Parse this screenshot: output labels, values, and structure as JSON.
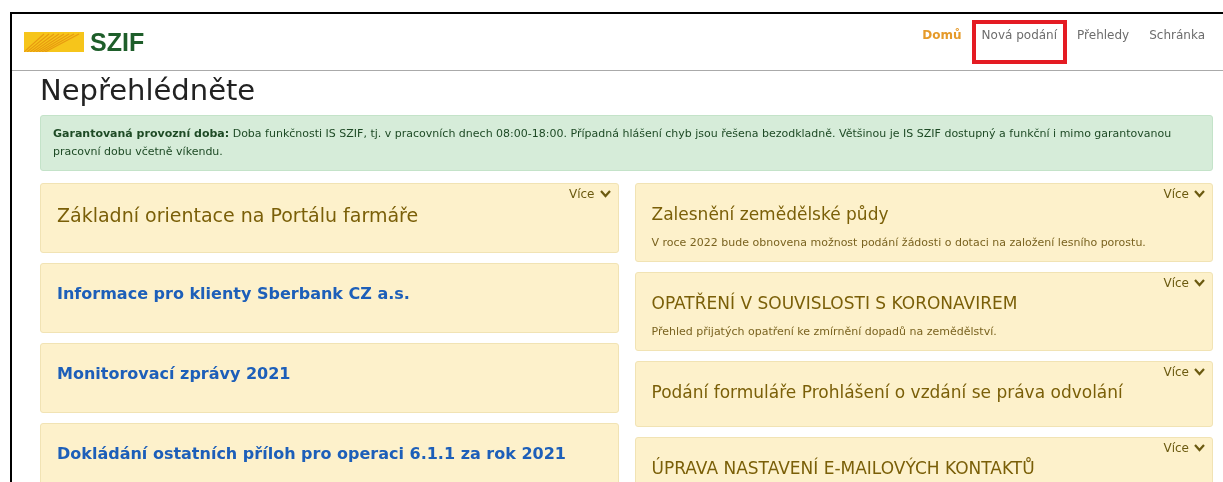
{
  "header": {
    "logo_text": "SZIF",
    "nav": [
      {
        "label": "Domů",
        "selected": true,
        "highlighted": false
      },
      {
        "label": "Nová podání",
        "selected": false,
        "highlighted": true
      },
      {
        "label": "Přehledy",
        "selected": false,
        "highlighted": false
      },
      {
        "label": "Schránka",
        "selected": false,
        "highlighted": false
      }
    ]
  },
  "page_title": "Nepřehlédněte",
  "notice": "**Garantovaná provozní doba:** Doba funkčnosti IS SZIF, tj. v pracovních dnech 08:00-18:00. Případná hlášení chyb jsou řešena bezodkladně. Většinou je IS SZIF dostupný a funkční i mimo garantovanou pracovní dobu včetně víkendu.",
  "left_cards": [
    {
      "kind": "heading",
      "title": "Základní orientace na Portálu farmáře",
      "more": "Více"
    },
    {
      "kind": "link",
      "title": "Informace pro klienty Sberbank CZ a.s."
    },
    {
      "kind": "link",
      "title": "Monitorovací zprávy 2021"
    },
    {
      "kind": "link",
      "title": "Dokládání ostatních příloh pro operaci 6.1.1 za rok 2021"
    }
  ],
  "right_cards": [
    {
      "kind": "heading",
      "title": "Zalesnění zemědělské půdy",
      "text": "V roce 2022 bude obnovena možnost podání žádosti o dotaci na založení lesního porostu.",
      "more": "Více"
    },
    {
      "kind": "heading",
      "title": "OPATŘENÍ V SOUVISLOSTI S KORONAVIREM",
      "text": "Přehled přijatých opatření ke zmírnění dopadů na zemědělství.",
      "more": "Více"
    },
    {
      "kind": "heading",
      "title": "Podání formuláře Prohlášení o vzdání se práva odvolání",
      "more": "Více"
    },
    {
      "kind": "heading",
      "title": "ÚPRAVA NASTAVENÍ E-MAILOVÝCH KONTAKTŮ",
      "more": "Více"
    }
  ]
}
